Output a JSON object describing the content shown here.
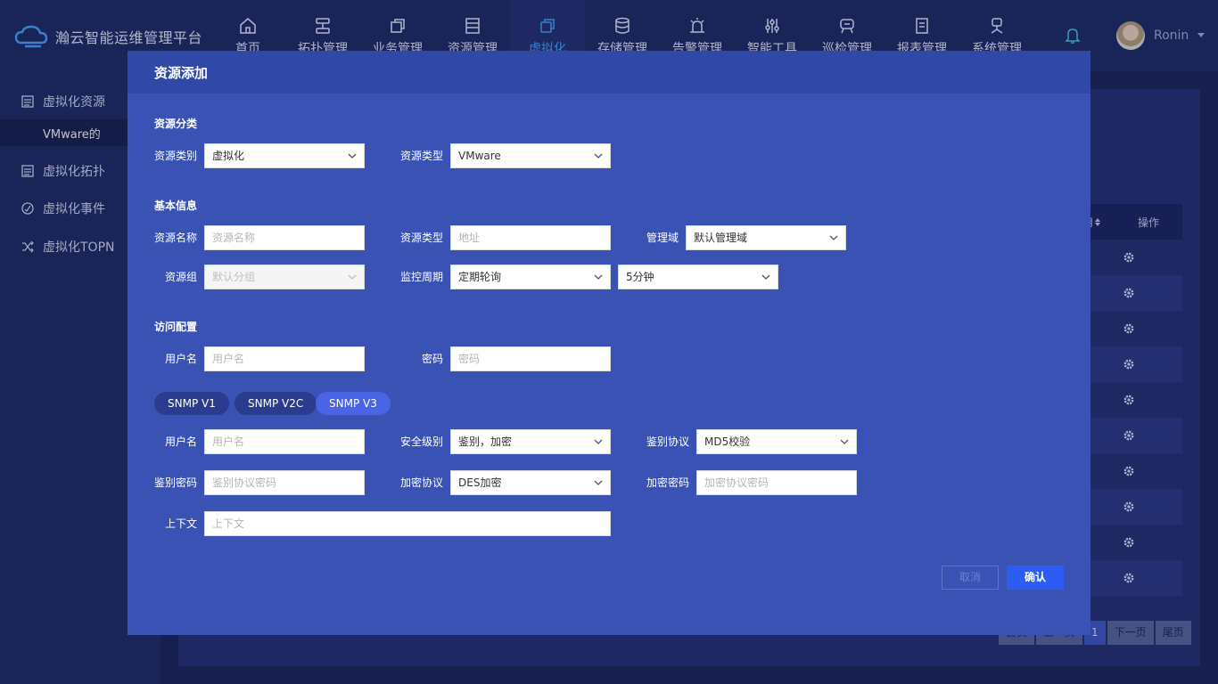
{
  "app": {
    "title": "瀚云智能运维管理平台"
  },
  "nav": {
    "items": [
      {
        "label": "首页",
        "icon": "home-icon"
      },
      {
        "label": "拓扑管理",
        "icon": "topology-icon"
      },
      {
        "label": "业务管理",
        "icon": "business-icon"
      },
      {
        "label": "资源管理",
        "icon": "resource-icon"
      },
      {
        "label": "虚拟化",
        "icon": "virtualization-icon",
        "active": true
      },
      {
        "label": "存储管理",
        "icon": "database-icon"
      },
      {
        "label": "告警管理",
        "icon": "alarm-icon"
      },
      {
        "label": "智能工具",
        "icon": "sliders-icon"
      },
      {
        "label": "巡检管理",
        "icon": "inspection-icon"
      },
      {
        "label": "报表管理",
        "icon": "report-icon"
      },
      {
        "label": "系统管理",
        "icon": "system-icon"
      }
    ]
  },
  "user": {
    "name": "Ronin"
  },
  "sidebar": {
    "items": [
      {
        "label": "虚拟化资源",
        "icon": "list-icon"
      },
      {
        "label": "VMware的",
        "sub": true
      },
      {
        "label": "虚拟化拓扑",
        "icon": "list-icon"
      },
      {
        "label": "虚拟化事件",
        "icon": "clock-icon"
      },
      {
        "label": "虚拟化TOPN",
        "icon": "shuffle-icon"
      }
    ]
  },
  "bg_table": {
    "partial_header": "用",
    "action_header": "操作",
    "rows": 10
  },
  "pager": {
    "first": "首页",
    "prev": "上一页",
    "current": "1",
    "next": "下一页",
    "last": "尾页"
  },
  "modal": {
    "title": "资源添加",
    "section_category": "资源分类",
    "category_label": "资源类别",
    "category_value": "虚拟化",
    "type_label": "资源类型",
    "type_value": "VMware",
    "section_basic": "基本信息",
    "name_label": "资源名称",
    "name_placeholder": "资源名称",
    "address_label": "资源类型",
    "address_placeholder": "地址",
    "domain_label": "管理域",
    "domain_value": "默认管理域",
    "group_label": "资源组",
    "group_value": "默认分组",
    "monitor_label": "监控周期",
    "monitor_mode": "定期轮询",
    "monitor_interval": "5分钟",
    "section_access": "访问配置",
    "user_label": "用户名",
    "user_placeholder": "用户名",
    "password_label": "密码",
    "password_placeholder": "密码",
    "snmp_tabs": [
      "SNMP V1",
      "SNMP V2C",
      "SNMP V3"
    ],
    "snmp_active": "SNMP V3",
    "snmp_user_label": "用户名",
    "snmp_user_placeholder": "用户名",
    "security_label": "安全级别",
    "security_value": "鉴别，加密",
    "auth_protocol_label": "鉴别协议",
    "auth_protocol_value": "MD5校验",
    "auth_password_label": "鉴别密码",
    "auth_password_placeholder": "鉴别协议密码",
    "encrypt_protocol_label": "加密协议",
    "encrypt_protocol_value": "DES加密",
    "encrypt_password_label": "加密密码",
    "encrypt_password_placeholder": "加密协议密码",
    "context_label": "上下文",
    "context_placeholder": "上下文",
    "cancel": "取消",
    "ok": "确认"
  }
}
